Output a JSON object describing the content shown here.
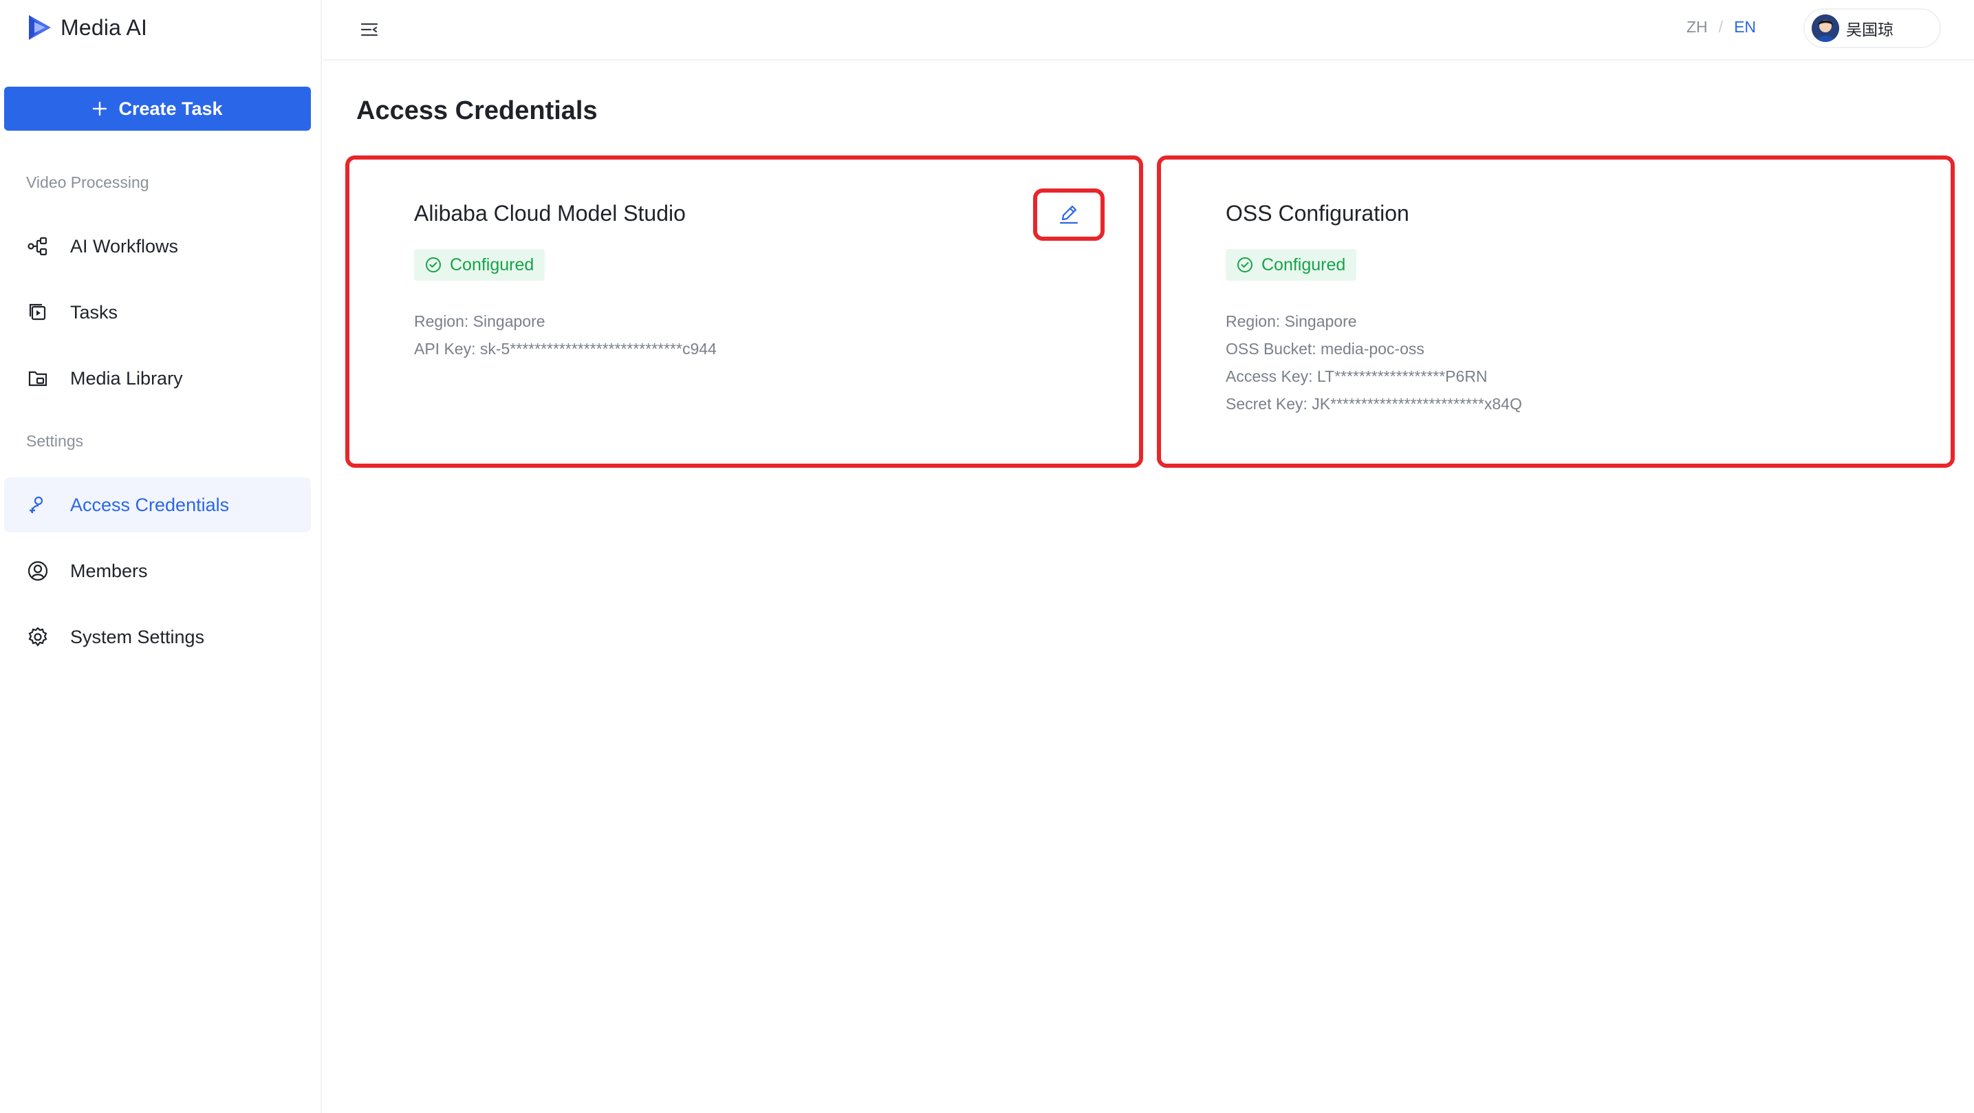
{
  "app": {
    "name": "Media AI"
  },
  "sidebar": {
    "create_label": "Create Task",
    "sections": [
      {
        "label": "Video Processing"
      },
      {
        "label": "Settings"
      }
    ],
    "items": [
      {
        "label": "AI Workflows",
        "icon": "workflow-icon"
      },
      {
        "label": "Tasks",
        "icon": "tasks-icon"
      },
      {
        "label": "Media Library",
        "icon": "folder-icon"
      },
      {
        "label": "Access Credentials",
        "icon": "key-user-icon",
        "active": true
      },
      {
        "label": "Members",
        "icon": "user-circle-icon"
      },
      {
        "label": "System Settings",
        "icon": "gear-icon"
      }
    ]
  },
  "header": {
    "lang_zh": "ZH",
    "lang_sep": "/",
    "lang_en": "EN",
    "active_lang": "EN",
    "user_name": "吴国琼"
  },
  "main": {
    "title": "Access Credentials",
    "cards": [
      {
        "title": "Alibaba Cloud Model Studio",
        "status": "Configured",
        "details": [
          "Region: Singapore",
          "API Key: sk-5****************************c944"
        ]
      },
      {
        "title": "OSS Configuration",
        "status": "Configured",
        "details": [
          "Region: Singapore",
          "OSS Bucket: media-poc-oss",
          "Access Key: LT******************P6RN",
          "Secret Key: JK*************************x84Q"
        ]
      }
    ]
  },
  "colors": {
    "accent": "#2a66e8",
    "success": "#17a34a",
    "success_bg": "#e9f8ef",
    "highlight": "#e8262a"
  }
}
